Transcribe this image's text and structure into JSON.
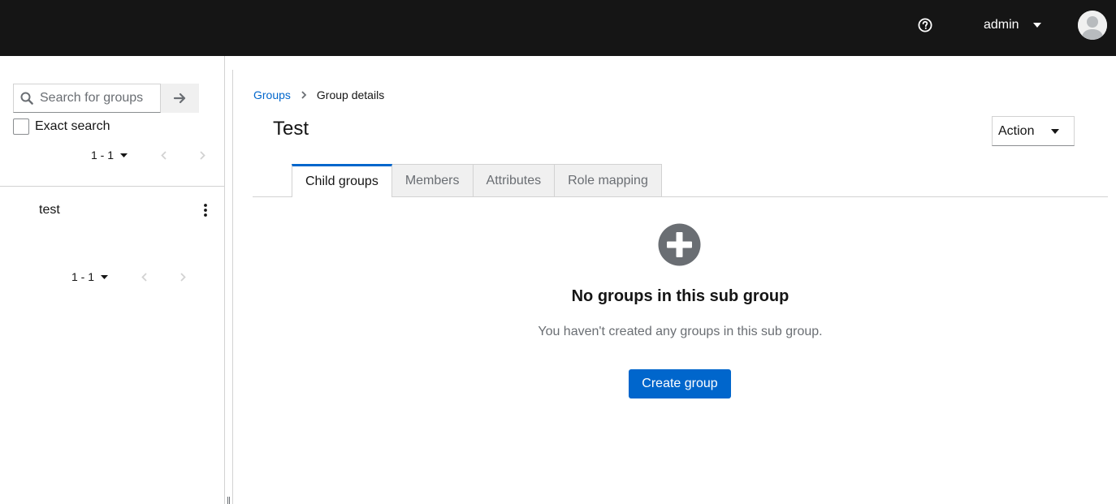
{
  "header": {
    "help_icon": "help-circle-icon",
    "username": "admin",
    "avatar_icon": "user-avatar-icon"
  },
  "sidebar": {
    "search": {
      "placeholder": "Search for groups",
      "value": ""
    },
    "exact_search_label": "Exact search",
    "exact_search_checked": false,
    "top_pager": {
      "range": "1 - 1"
    },
    "groups": [
      {
        "name": "test"
      }
    ],
    "bottom_pager": {
      "range": "1 - 1"
    }
  },
  "breadcrumb": {
    "items": [
      {
        "label": "Groups"
      },
      {
        "label": "Group details"
      }
    ]
  },
  "page": {
    "title": "Test",
    "action_label": "Action"
  },
  "tabs": [
    {
      "label": "Child groups",
      "active": true
    },
    {
      "label": "Members",
      "active": false
    },
    {
      "label": "Attributes",
      "active": false
    },
    {
      "label": "Role mapping",
      "active": false
    }
  ],
  "empty_state": {
    "icon": "plus-circle-icon",
    "title": "No groups in this sub group",
    "body": "You haven't created any groups in this sub group.",
    "button_label": "Create group"
  },
  "colors": {
    "masthead": "#151515",
    "link": "#0066cc",
    "primary": "#0066cc",
    "muted": "#6a6e73"
  }
}
